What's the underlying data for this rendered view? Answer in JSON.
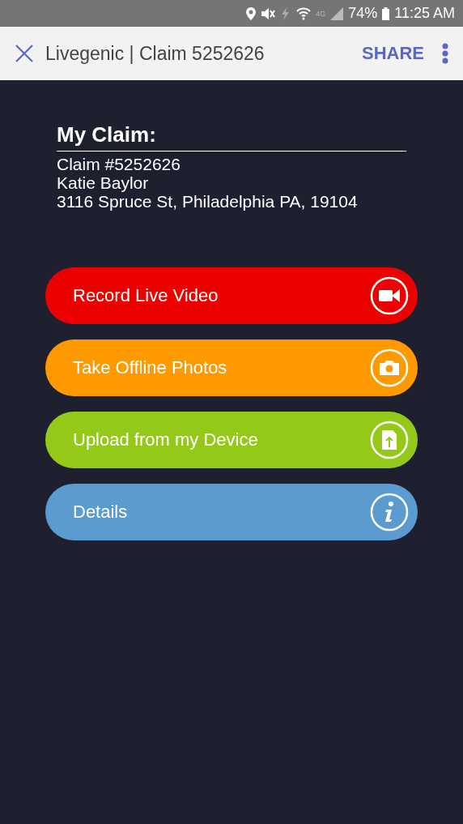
{
  "status_bar": {
    "network": "4G",
    "battery": "74%",
    "time": "11:25 AM"
  },
  "app_bar": {
    "title": "Livegenic | Claim 5252626",
    "action": "SHARE"
  },
  "claim": {
    "heading": "My Claim:",
    "lines": [
      "Claim #5252626",
      "Katie Baylor",
      "3116 Spruce St, Philadelphia PA, 19104"
    ]
  },
  "actions": [
    {
      "label": "Record Live Video",
      "kind": "video",
      "color": "#ee0000"
    },
    {
      "label": "Take Offline Photos",
      "kind": "camera",
      "color": "#ff9900"
    },
    {
      "label": "Upload from my Device",
      "kind": "upload",
      "color": "#95c919"
    },
    {
      "label": "Details",
      "kind": "info",
      "color": "#5b9bd0"
    }
  ]
}
